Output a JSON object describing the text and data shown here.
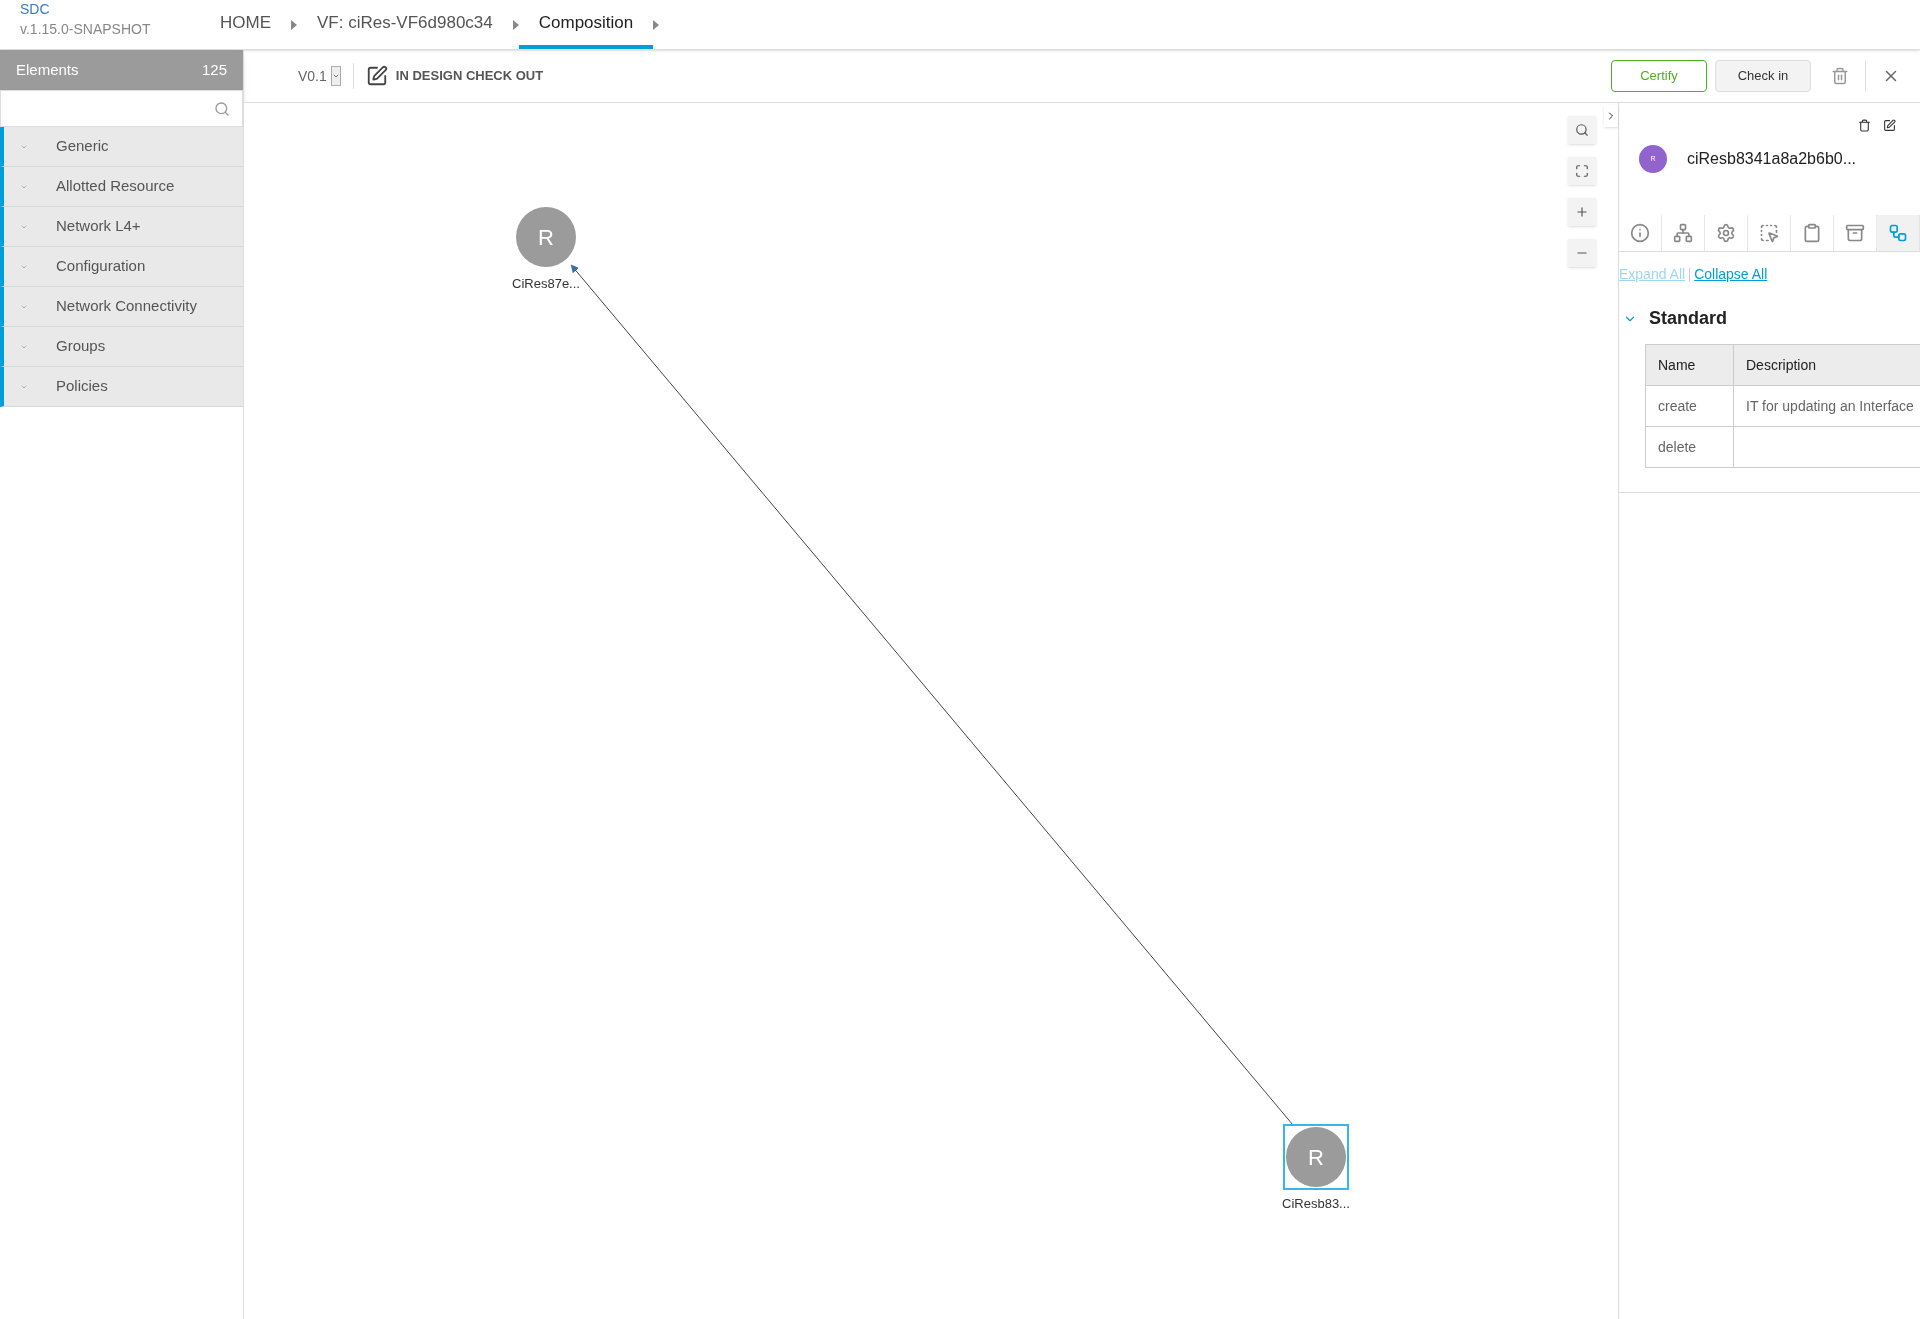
{
  "app": {
    "name": "SDC",
    "version": "v.1.15.0-SNAPSHOT"
  },
  "breadcrumbs": [
    {
      "label": "HOME",
      "selected": false
    },
    {
      "label": "VF: ciRes-VF6d980c34",
      "selected": false
    },
    {
      "label": "Composition",
      "selected": true
    }
  ],
  "sidebar": {
    "title": "Elements",
    "count": "125",
    "categories": [
      "Generic",
      "Allotted Resource",
      "Network L4+",
      "Configuration",
      "Network Connectivity",
      "Groups",
      "Policies"
    ]
  },
  "toolbar": {
    "version": "V0.1",
    "status": "IN DESIGN CHECK OUT",
    "buttons": [
      {
        "label": "Certify",
        "kind": "primary"
      },
      {
        "label": "Check in",
        "kind": "secondary"
      }
    ]
  },
  "canvas": {
    "nodes": [
      {
        "letter": "R",
        "label": "CiRes87e...",
        "selected": false
      },
      {
        "letter": "R",
        "label": "CiResb83...",
        "selected": true
      }
    ]
  },
  "details": {
    "letter": "R",
    "title": "ciResb8341a8a2b6b0...",
    "tabs": [
      {
        "kind": "info",
        "selected": false
      },
      {
        "kind": "composition",
        "selected": false
      },
      {
        "kind": "settings",
        "selected": false
      },
      {
        "kind": "attributes",
        "selected": false
      },
      {
        "kind": "clipboard",
        "selected": false
      },
      {
        "kind": "archive",
        "selected": false
      },
      {
        "kind": "relations",
        "selected": true
      }
    ],
    "expand_all": "Expand All",
    "collapse_all": "Collapse All",
    "section": "Standard",
    "expanded": true,
    "columns": [
      "Name",
      "Description"
    ],
    "rows": [
      [
        "create",
        "IT for updating an Interface"
      ],
      [
        "delete",
        ""
      ]
    ]
  }
}
